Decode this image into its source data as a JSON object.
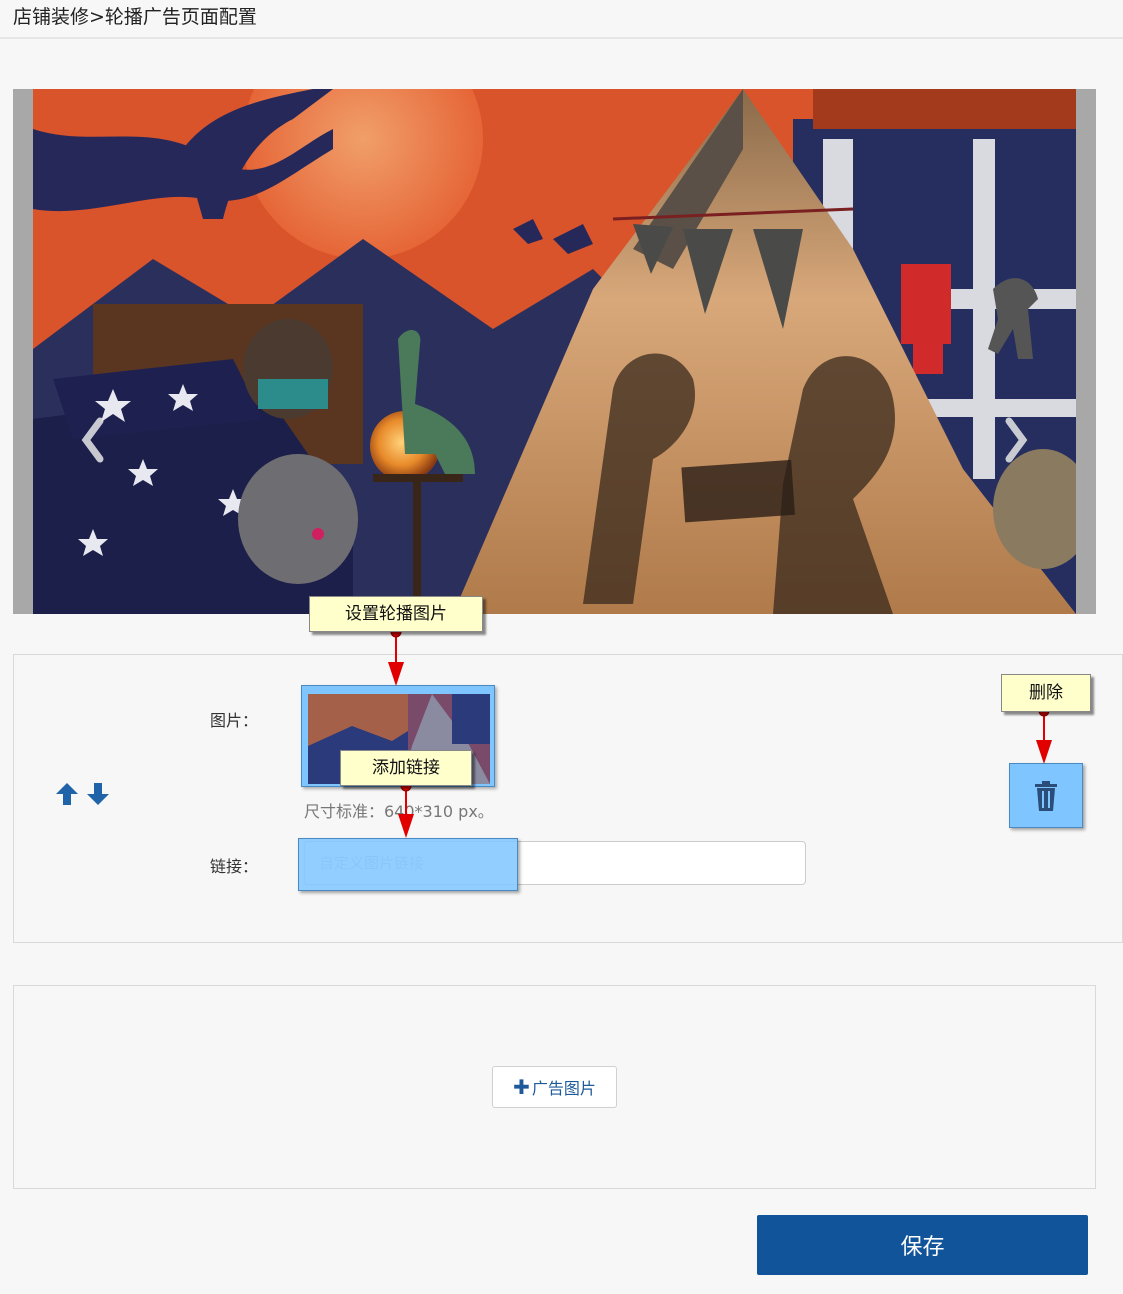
{
  "header": {
    "breadcrumb": "店铺装修>轮播广告页面配置"
  },
  "carousel": {
    "prev_icon": "chevron-left-icon",
    "next_icon": "chevron-right-icon"
  },
  "editor": {
    "image_label": "图片：",
    "size_hint": "尺寸标准：640*310 px。",
    "link_label": "链接：",
    "link_placeholder": "自定义图片链接",
    "link_value": "",
    "sort_icons": [
      "arrow-up-icon",
      "arrow-down-icon"
    ],
    "delete_icon": "trash-icon"
  },
  "annotations": {
    "set_image": "设置轮播图片",
    "add_link": "添加链接",
    "delete": "删除"
  },
  "add_panel": {
    "button_label": "广告图片"
  },
  "footer": {
    "save_label": "保存"
  },
  "colors": {
    "primary": "#12549a",
    "highlight": "#7fc5ff",
    "callout_bg": "#ffffcc",
    "arrow_red": "#e00000"
  }
}
